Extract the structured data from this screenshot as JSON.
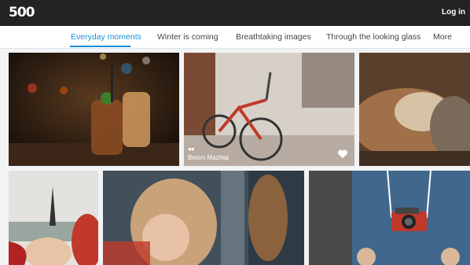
{
  "header": {
    "logo": "500",
    "login_label": "Log in"
  },
  "tabs": [
    {
      "label": "Everyday moments",
      "active": true
    },
    {
      "label": "Winter is coming",
      "active": false
    },
    {
      "label": "Breathtaking images",
      "active": false
    },
    {
      "label": "Through the looking glass",
      "active": false
    },
    {
      "label": "More",
      "active": false
    }
  ],
  "photos": [
    {
      "subject": "drinks in mason jars at night"
    },
    {
      "subject": "red bicycle on snowy street",
      "author": "Besim Mazhiqi",
      "liked": false
    },
    {
      "subject": "dog sleeping with cat"
    },
    {
      "subject": "girl under Eiffel tower"
    },
    {
      "subject": "blonde girl by window"
    },
    {
      "subject": "person in blue sweater holding camera"
    }
  ],
  "colors": {
    "accent": "#1a8fd8",
    "topbar": "#222324"
  }
}
